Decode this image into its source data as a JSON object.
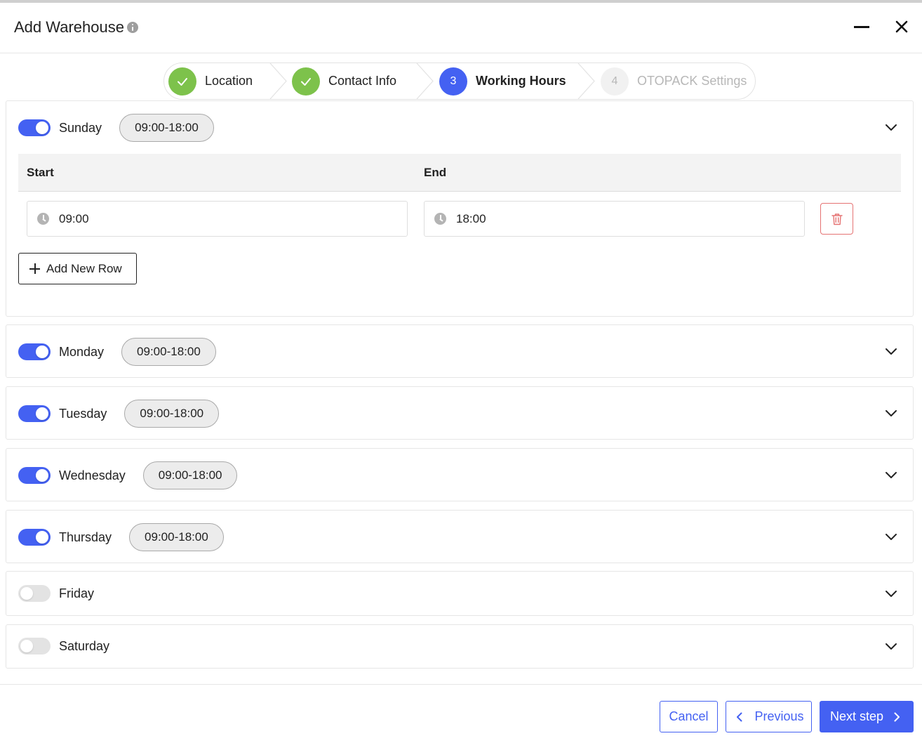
{
  "modal": {
    "title": "Add Warehouse"
  },
  "stepper": {
    "steps": [
      {
        "label": "Location",
        "number": "",
        "status": "done"
      },
      {
        "label": "Contact Info",
        "number": "",
        "status": "done"
      },
      {
        "label": "Working Hours",
        "number": "3",
        "status": "active"
      },
      {
        "label": "OTOPACK Settings",
        "number": "4",
        "status": "pending"
      }
    ]
  },
  "schedule": {
    "columns": {
      "start": "Start",
      "end": "End"
    },
    "add_row_label": "Add New Row",
    "days": [
      {
        "name": "Sunday",
        "enabled": true,
        "hours": "09:00-18:00",
        "expanded": true,
        "rows": [
          {
            "start": "09:00",
            "end": "18:00"
          }
        ]
      },
      {
        "name": "Monday",
        "enabled": true,
        "hours": "09:00-18:00",
        "expanded": false
      },
      {
        "name": "Tuesday",
        "enabled": true,
        "hours": "09:00-18:00",
        "expanded": false
      },
      {
        "name": "Wednesday",
        "enabled": true,
        "hours": "09:00-18:00",
        "expanded": false
      },
      {
        "name": "Thursday",
        "enabled": true,
        "hours": "09:00-18:00",
        "expanded": false
      },
      {
        "name": "Friday",
        "enabled": false,
        "hours": "",
        "expanded": false
      },
      {
        "name": "Saturday",
        "enabled": false,
        "hours": "",
        "expanded": false
      }
    ]
  },
  "footer": {
    "cancel_label": "Cancel",
    "previous_label": "Previous",
    "next_label": "Next step"
  },
  "colors": {
    "primary": "#4461f2",
    "success": "#7dc24b",
    "danger": "#e57373",
    "toggle_off": "#e3e3e3"
  }
}
